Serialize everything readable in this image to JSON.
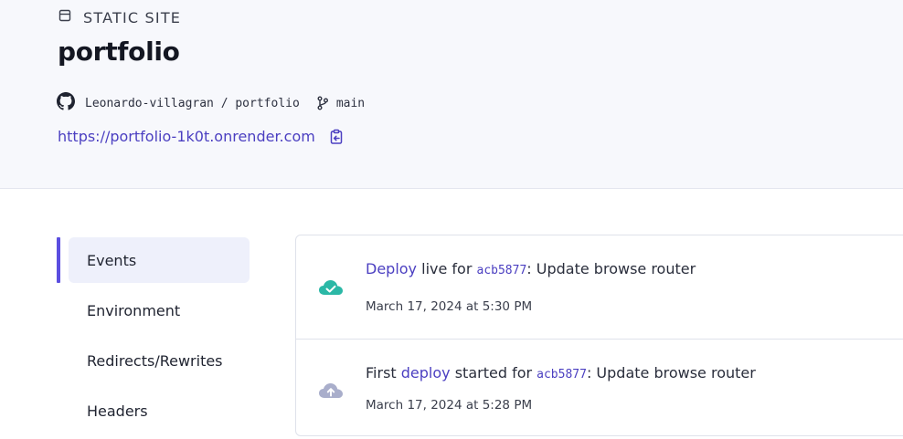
{
  "service": {
    "type_label": "STATIC SITE",
    "name": "portfolio",
    "repo": "Leonardo-villagran / portfolio",
    "branch": "main",
    "url": "https://portfolio-1k0t.onrender.com"
  },
  "colors": {
    "accent": "#5b4ee0",
    "link": "#4b3fc1",
    "success": "#2bb8a6",
    "pending": "#a9aecb"
  },
  "icons": {
    "type": "site-icon",
    "repo": "github-icon",
    "branch": "git-branch-icon",
    "copy": "copy-icon",
    "deploy_live": "cloud-check-icon",
    "deploy_started": "cloud-upload-icon"
  },
  "nav": {
    "items": [
      {
        "label": "Events",
        "active": true
      },
      {
        "label": "Environment",
        "active": false
      },
      {
        "label": "Redirects/Rewrites",
        "active": false
      },
      {
        "label": "Headers",
        "active": false
      }
    ]
  },
  "events": [
    {
      "prefix": "",
      "link": "Deploy",
      "middle": " live for ",
      "hash": "acb5877",
      "message": ": Update browse router",
      "time": "March 17, 2024 at 5:30 PM"
    },
    {
      "prefix": "First ",
      "link": "deploy",
      "middle": " started for ",
      "hash": "acb5877",
      "message": ": Update browse router",
      "time": "March 17, 2024 at 5:28 PM"
    }
  ]
}
